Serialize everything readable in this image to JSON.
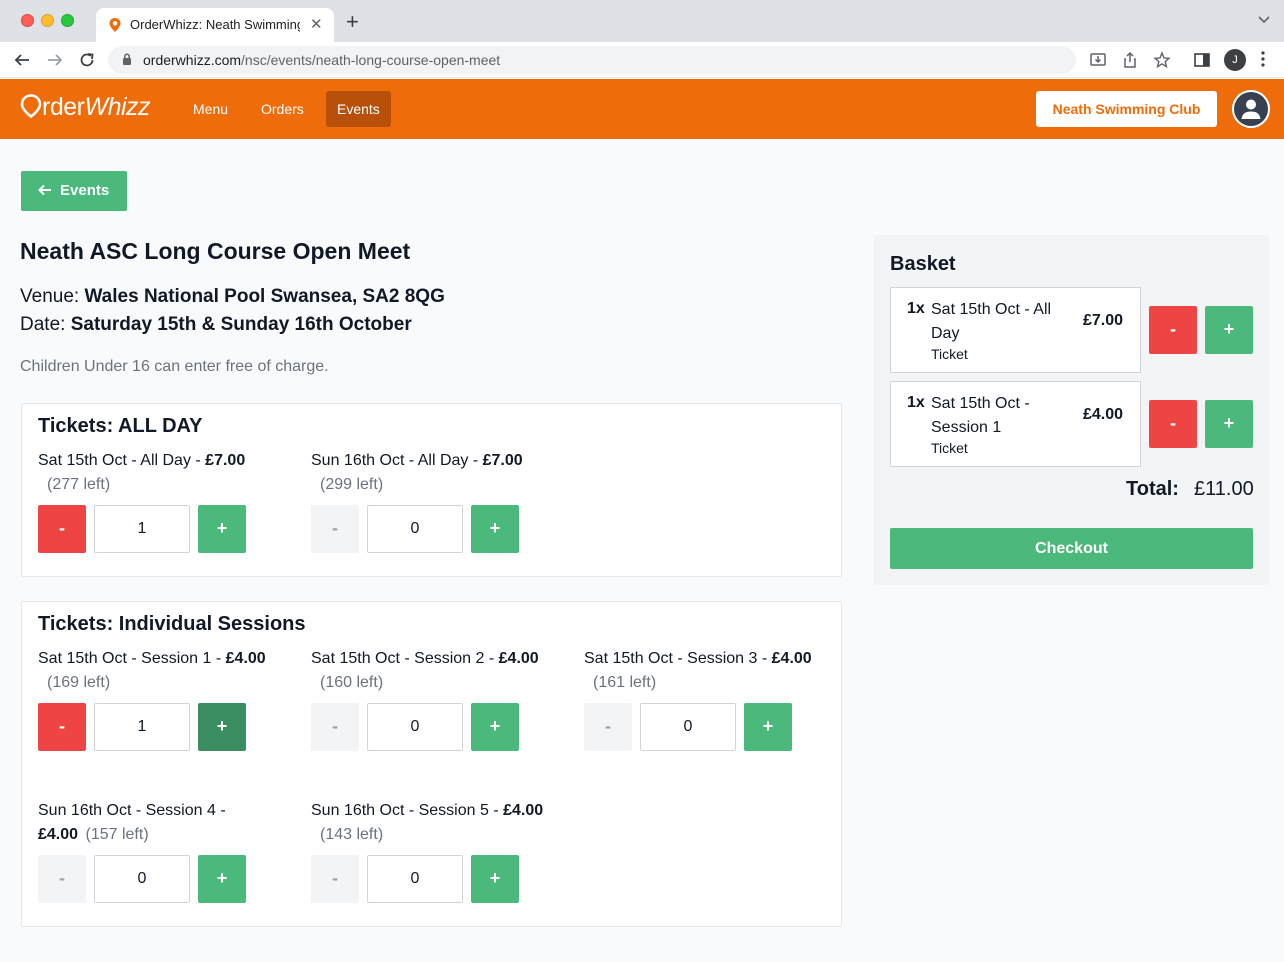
{
  "browser": {
    "tab_title": "OrderWhizz: Neath Swimming Club",
    "url_host": "orderwhizz.com",
    "url_path": "/nsc/events/neath-long-course-open-meet",
    "profile_initial": "J"
  },
  "header": {
    "logo_prefix": "rder",
    "logo_suffix": "Whizz",
    "nav": [
      "Menu",
      "Orders",
      "Events"
    ],
    "active_nav": "Events",
    "club_button": "Neath Swimming Club",
    "brand_color": "#ef6c0a"
  },
  "page": {
    "back_label": "Events",
    "title": "Neath ASC Long Course Open Meet",
    "venue_label": "Venue:",
    "venue": "Wales National Pool Swansea, SA2 8QG",
    "date_label": "Date:",
    "date": "Saturday 15th & Sunday 16th October",
    "note": "Children Under 16 can enter free of charge."
  },
  "allday": {
    "title": "Tickets: ALL DAY",
    "tickets": [
      {
        "name": "Sat 15th Oct - All Day - ",
        "price": "£7.00",
        "left": "(277 left)",
        "qty": "1",
        "minus": "-",
        "plus": "+"
      },
      {
        "name": "Sun 16th Oct - All Day - ",
        "price": "£7.00",
        "left": "(299 left)",
        "qty": "0",
        "minus": "-",
        "plus": "+"
      }
    ]
  },
  "sessions": {
    "title": "Tickets: Individual Sessions",
    "tickets": [
      {
        "name": "Sat 15th Oct - Session 1 - ",
        "price": "£4.00",
        "left": "(169 left)",
        "qty": "1",
        "minus": "-",
        "plus": "+"
      },
      {
        "name": "Sat 15th Oct - Session 2 - ",
        "price": "£4.00",
        "left": "(160 left)",
        "qty": "0",
        "minus": "-",
        "plus": "+"
      },
      {
        "name": "Sat 15th Oct - Session 3 - ",
        "price": "£4.00",
        "left": "(161 left)",
        "qty": "0",
        "minus": "-",
        "plus": "+"
      },
      {
        "name": "Sun 16th Oct - Session 4 - ",
        "price": "£4.00",
        "left": "(157 left)",
        "qty": "0",
        "minus": "-",
        "plus": "+"
      },
      {
        "name": "Sun 16th Oct - Session 5 - ",
        "price": "£4.00",
        "left": "(143 left)",
        "qty": "0",
        "minus": "-",
        "plus": "+"
      }
    ]
  },
  "basket": {
    "title": "Basket",
    "items": [
      {
        "qty": "1x",
        "name": "Sat 15th Oct - All Day",
        "type": "Ticket",
        "price": "£7.00",
        "minus": "-",
        "plus": "+"
      },
      {
        "qty": "1x",
        "name": "Sat 15th Oct - Session 1",
        "type": "Ticket",
        "price": "£4.00",
        "minus": "-",
        "plus": "+"
      }
    ],
    "total_label": "Total:",
    "total": "£11.00",
    "checkout_label": "Checkout"
  }
}
